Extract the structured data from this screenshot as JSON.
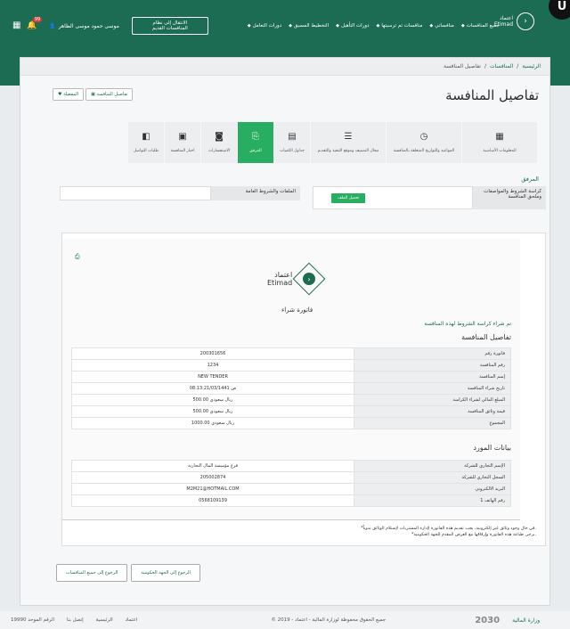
{
  "header": {
    "user_name": "موسى حمود موسى الظاهر",
    "notif_count": "99",
    "old_system": "الانتقال إلى نظام المنافسات القديم",
    "nav": [
      "دورات التعامل",
      "التخطيط المسبق",
      "دورات التأهيل",
      "منافسات تم ترسيتها",
      "منافساتي",
      "جميع المنافسات"
    ],
    "logo_ar": "اعتماد",
    "logo_en": "Etimad"
  },
  "breadcrumb": {
    "home": "الرئيسية",
    "sep": "/",
    "tenders": "المنافسات",
    "current": "تفاصيل المنافسة"
  },
  "page_title": "تفاصيل المنافسة",
  "toolbar": {
    "details": "تفاصيل المنافسة",
    "favorite": "المفضلة"
  },
  "tabs": [
    {
      "label": "المعلومات الأساسية",
      "icon": "▦"
    },
    {
      "label": "المواعيد والتواريخ المتعلقة بالمنافسة",
      "icon": "◷"
    },
    {
      "label": "مجال التصنيف وموقع التنفيذ والتقديم",
      "icon": "☰"
    },
    {
      "label": "جداول الكميات",
      "icon": "▤"
    },
    {
      "label": "المرفق",
      "icon": "⎘"
    },
    {
      "label": "الاستفسارات",
      "icon": "◙"
    },
    {
      "label": "اخبار المنافسة",
      "icon": "▣"
    },
    {
      "label": "طلبات التواصل",
      "icon": "◧"
    }
  ],
  "attachments": {
    "heading": "المرفق",
    "terms_label": "كراسة الشروط والمواصفات وملحق المنافسة",
    "download": "تحميل الملف",
    "general_label": "الملفات والشروط العامة"
  },
  "invoice": {
    "logo_ar": "اعتماد",
    "logo_en": "Etimad",
    "title": "فاتورة شراء",
    "bought_msg": "تم شراء كراسة الشروط لهذه المنافسة",
    "section1": "تفاصيل المنافسة",
    "rows1": [
      {
        "k": "فاتورة رقم",
        "v": "200301656"
      },
      {
        "k": "رقم المنافسة",
        "v": "1234"
      },
      {
        "k": "إسم المنافسة",
        "v": "NEW TENDER"
      },
      {
        "k": "تاريخ شراء المنافسة",
        "v": "08:13:21/03/1441 ص"
      },
      {
        "k": "المبلغ المالي لشراء الكراسة",
        "v": "500.00 ريال سعودي"
      },
      {
        "k": "قيمة وثائق المنافسة",
        "v": "500.00 ريال سعودي"
      },
      {
        "k": "المجموع",
        "v": "1000.00 ريال سعودي"
      }
    ],
    "section2": "بيانات المورد",
    "rows2": [
      {
        "k": "الإسم التجاري للشركة",
        "v": "فرع مؤسسة المال التجارية"
      },
      {
        "k": "السجل التجاري للشركة",
        "v": "205002874"
      },
      {
        "k": "البريد الالكتروني",
        "v": "M2M21@HOTMAIL.COM"
      },
      {
        "k": "رقم الهاتف 1",
        "v": "0568109139"
      }
    ],
    "note1": "*في حال وجود وثائق غير إلكترونية، يجب تقديم هذه الفاتورة لإدارة المشتريات لإستلام الوثائق يدوياً.",
    "note2": "*يرجى طباعة هذه الفاتورة وإرفاقها مع العرض المقدم للجهة الحكومية."
  },
  "back": {
    "agency": "الرجوع إلى الجهة الحكومية",
    "all": "الرجوع إلى جميع المنافسات"
  },
  "footer": {
    "links": [
      "اعتماد",
      "الرئيسية",
      "إتصل بنا",
      "الرقم الموحد 19990"
    ],
    "copyright": "© جميع الحقوق محفوظة لوزارة المالية - اعتماد - 2019",
    "vision": "2030",
    "mof": "وزارة المالية"
  }
}
